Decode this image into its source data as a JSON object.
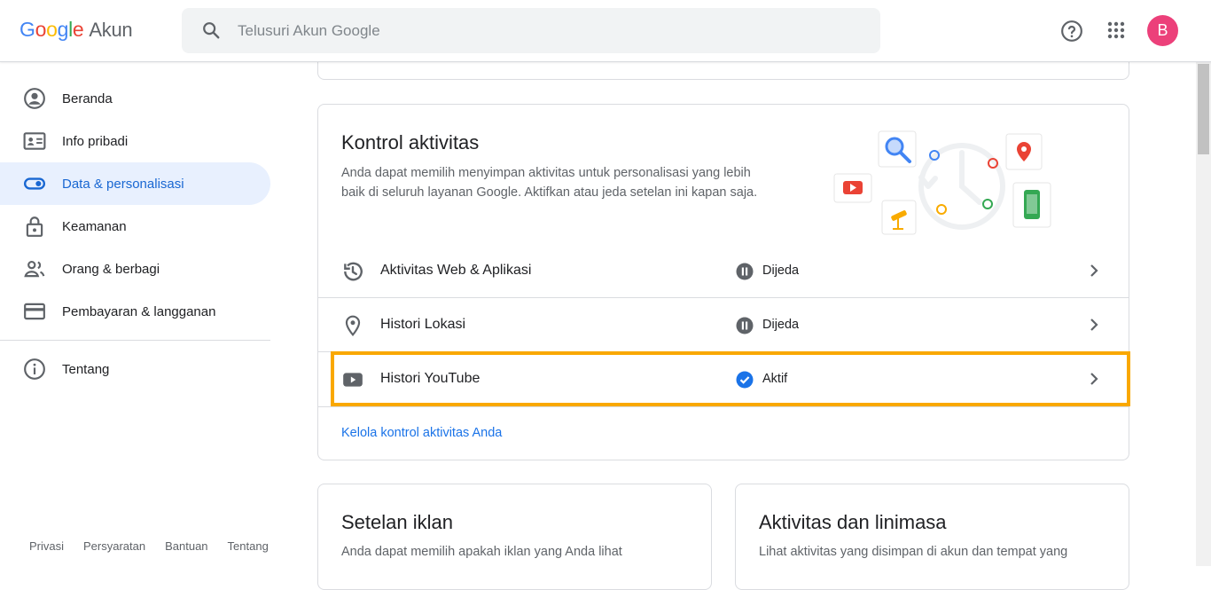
{
  "header": {
    "logo_google": "Google",
    "logo_product": "Akun",
    "search_placeholder": "Telusuri Akun Google",
    "avatar_letter": "B"
  },
  "sidebar": {
    "items": [
      {
        "label": "Beranda",
        "icon": "account-circle-icon",
        "active": false
      },
      {
        "label": "Info pribadi",
        "icon": "id-card-icon",
        "active": false
      },
      {
        "label": "Data & personalisasi",
        "icon": "toggle-icon",
        "active": true
      },
      {
        "label": "Keamanan",
        "icon": "lock-icon",
        "active": false
      },
      {
        "label": "Orang & berbagi",
        "icon": "people-icon",
        "active": false
      },
      {
        "label": "Pembayaran & langganan",
        "icon": "credit-card-icon",
        "active": false
      }
    ],
    "about": {
      "label": "Tentang",
      "icon": "info-icon"
    },
    "footer": [
      "Privasi",
      "Persyaratan",
      "Bantuan",
      "Tentang"
    ]
  },
  "activity_card": {
    "title": "Kontrol aktivitas",
    "description": "Anda dapat memilih menyimpan aktivitas untuk personalisasi yang lebih baik di seluruh layanan Google. Aktifkan atau jeda setelan ini kapan saja.",
    "rows": [
      {
        "label": "Aktivitas Web & Aplikasi",
        "icon": "history-icon",
        "status": "Dijeda",
        "status_icon": "pause-icon"
      },
      {
        "label": "Histori Lokasi",
        "icon": "location-pin-icon",
        "status": "Dijeda",
        "status_icon": "pause-icon"
      },
      {
        "label": "Histori YouTube",
        "icon": "youtube-icon",
        "status": "Aktif",
        "status_icon": "check-circle-icon"
      }
    ],
    "manage_link": "Kelola kontrol aktivitas Anda"
  },
  "ads_card": {
    "title": "Setelan iklan",
    "description": "Anda dapat memilih apakah iklan yang Anda lihat"
  },
  "timeline_card": {
    "title": "Aktivitas dan linimasa",
    "description": "Lihat aktivitas yang disimpan di akun dan tempat yang"
  },
  "colors": {
    "accent": "#1a73e8",
    "active_nav_bg": "#e8f0fe",
    "highlight": "#f9a800",
    "avatar_bg": "#ec407a"
  }
}
